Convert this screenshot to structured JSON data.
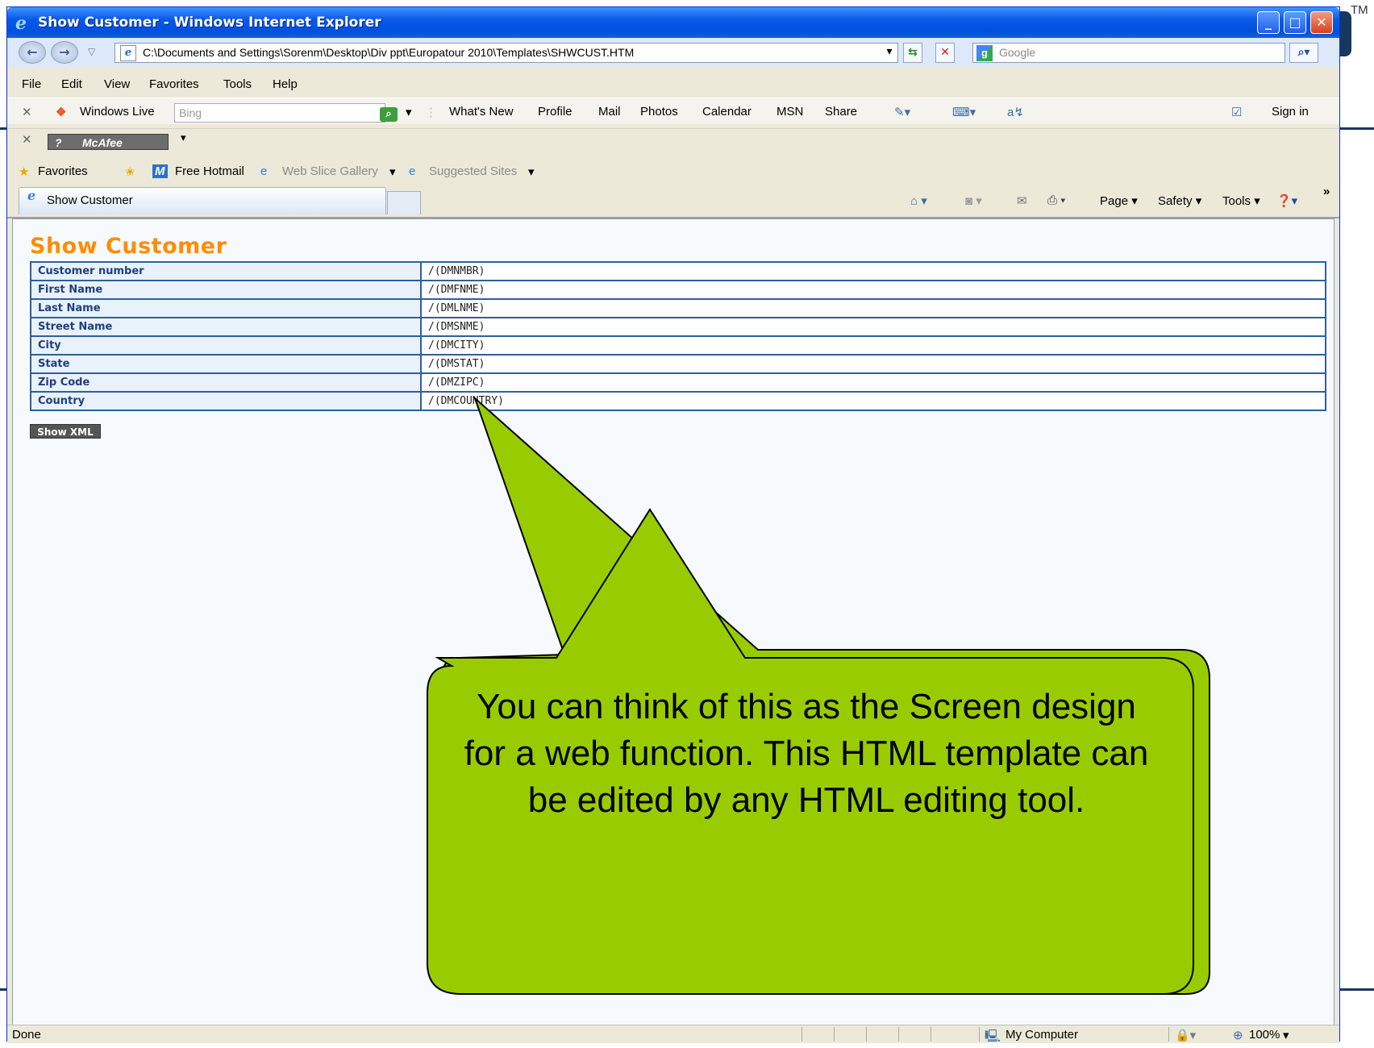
{
  "window": {
    "title": "Show Customer - Windows Internet Explorer",
    "minimize": "_",
    "maximize": "□",
    "close": "✕"
  },
  "slide": {
    "trademark": "TM"
  },
  "address_bar": {
    "url": "C:\\Documents and Settings\\Sorenm\\Desktop\\Div ppt\\Europatour 2010\\Templates\\SHWCUST.HTM",
    "search_placeholder": "Google"
  },
  "menu": [
    "File",
    "Edit",
    "View",
    "Favorites",
    "Tools",
    "Help"
  ],
  "windows_live_bar": {
    "brand": "Windows Live",
    "search_placeholder": "Bing",
    "links": [
      "What's New",
      "Profile",
      "Mail",
      "Photos",
      "Calendar",
      "MSN",
      "Share"
    ],
    "sign_in": "Sign in"
  },
  "mcafee": {
    "label": "McAfee"
  },
  "favorites_bar": {
    "favorites": "Favorites",
    "items": [
      "Free Hotmail",
      "Web Slice Gallery",
      "Suggested Sites"
    ]
  },
  "tab": {
    "label": "Show Customer"
  },
  "command_bar": [
    "Page",
    "Safety",
    "Tools"
  ],
  "page": {
    "heading": "Show Customer",
    "rows": [
      {
        "label": "Customer number",
        "value": "/(DMNMBR)"
      },
      {
        "label": "First Name",
        "value": "/(DMFNME)"
      },
      {
        "label": "Last Name",
        "value": "/(DMLNME)"
      },
      {
        "label": "Street Name",
        "value": "/(DMSNME)"
      },
      {
        "label": "City",
        "value": "/(DMCITY)"
      },
      {
        "label": "State",
        "value": "/(DMSTAT)"
      },
      {
        "label": "Zip Code",
        "value": "/(DMZIPC)"
      },
      {
        "label": "Country",
        "value": "/(DMCOUNTRY)"
      }
    ],
    "button": "Show XML"
  },
  "callout": {
    "text": "You can think of this as the Screen design for a web function. This HTML template can be edited by any HTML editing tool.",
    "color": "#99cc00"
  },
  "status_bar": {
    "status": "Done",
    "zone": "My Computer",
    "zoom": "100%"
  }
}
